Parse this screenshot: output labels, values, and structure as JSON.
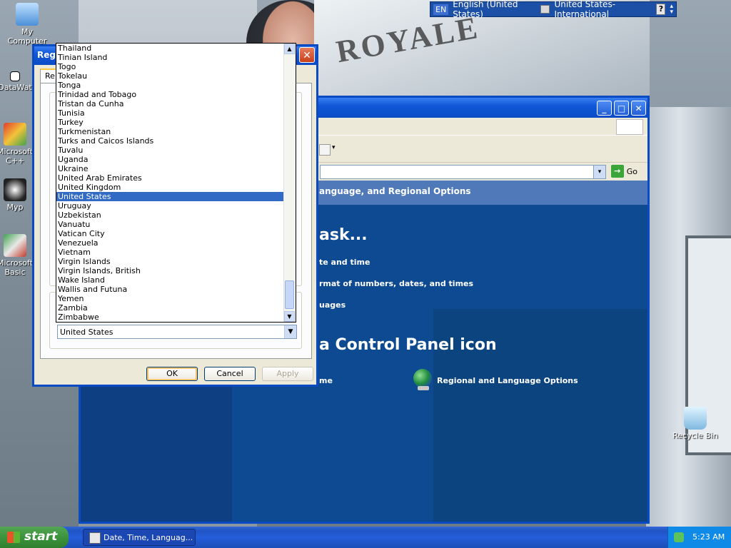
{
  "desktop": {
    "icons": [
      {
        "label": "My Computer"
      },
      {
        "label": "DataWat"
      },
      {
        "label": "Microsoft C++"
      },
      {
        "label": "Myp"
      },
      {
        "label": "Microsoft Basic"
      },
      {
        "label": "Recycle Bin"
      }
    ],
    "background_sign_text": "ROYALE"
  },
  "language_bar": {
    "lang_code": "EN",
    "language": "English (United States)",
    "keyboard": "United States-International",
    "help": "?"
  },
  "control_panel": {
    "go_label": "Go",
    "header": "anguage, and Regional Options",
    "task_title": "ask...",
    "tasks": [
      "te and time",
      "rmat of numbers, dates, and times",
      "uages"
    ],
    "icon_title": "a Control Panel icon",
    "icon_items": [
      "me",
      "Regional and Language Options"
    ]
  },
  "dialog": {
    "title": "Regi",
    "tab_label": "Re",
    "location_value": "United States",
    "buttons": {
      "ok": "OK",
      "cancel": "Cancel",
      "apply": "Apply"
    }
  },
  "dropdown": {
    "items": [
      "Thailand",
      "Tinian Island",
      "Togo",
      "Tokelau",
      "Tonga",
      "Trinidad and Tobago",
      "Tristan da Cunha",
      "Tunisia",
      "Turkey",
      "Turkmenistan",
      "Turks and Caicos Islands",
      "Tuvalu",
      "Uganda",
      "Ukraine",
      "United Arab Emirates",
      "United Kingdom",
      "United States",
      "Uruguay",
      "Uzbekistan",
      "Vanuatu",
      "Vatican City",
      "Venezuela",
      "Vietnam",
      "Virgin Islands",
      "Virgin Islands, British",
      "Wake Island",
      "Wallis and Futuna",
      "Yemen",
      "Zambia",
      "Zimbabwe"
    ],
    "selected": "United States"
  },
  "taskbar": {
    "start_label": "start",
    "task_item": "Date, Time, Languag...",
    "clock": "5:23 AM"
  },
  "colors": {
    "selection": "#316ac5",
    "title_blue": "#0b4bc6",
    "start_green": "#3c933c"
  }
}
